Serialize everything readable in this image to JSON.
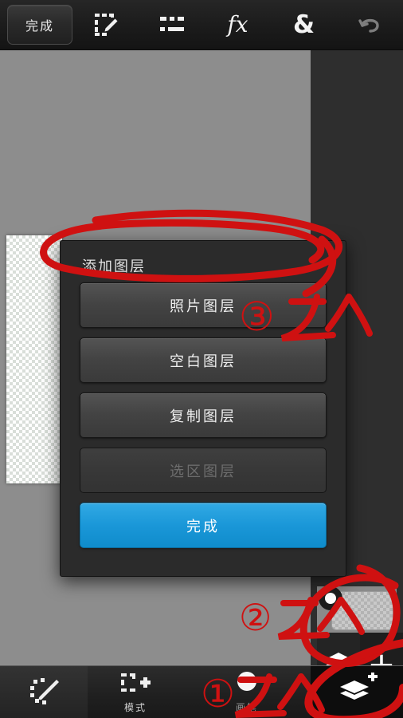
{
  "app": {
    "name": "photo-editor",
    "accent_blue": "#1a97d8",
    "annotation_red": "#cf1111",
    "canvas_background": "#8d8d8d",
    "panel_background": "#2b2b2b"
  },
  "topbar": {
    "done_label": "完成",
    "tools": [
      {
        "name": "selection-edit-icon",
        "label": "选择编辑",
        "enabled": true
      },
      {
        "name": "adjustments-icon",
        "label": "调整",
        "enabled": true
      },
      {
        "name": "effects-fx-icon",
        "label": "fx",
        "enabled": true
      },
      {
        "name": "blend-ampersand-icon",
        "label": "&",
        "enabled": true
      },
      {
        "name": "undo-icon",
        "label": "撤销",
        "enabled": false
      }
    ]
  },
  "dialog": {
    "title": "添加图层",
    "buttons": [
      {
        "label": "照片图层",
        "state": "enabled",
        "style": "normal"
      },
      {
        "label": "空白图层",
        "state": "enabled",
        "style": "normal"
      },
      {
        "label": "复制图层",
        "state": "enabled",
        "style": "normal"
      },
      {
        "label": "选区图层",
        "state": "disabled",
        "style": "normal"
      },
      {
        "label": "完成",
        "state": "enabled",
        "style": "primary"
      }
    ]
  },
  "layer_panel": {
    "thumbnail_alt": "transparent-layer-thumbnail",
    "visibility_on": true,
    "layers_button": "图层",
    "add_button": "+"
  },
  "bottombar": {
    "items": [
      {
        "name": "brush-select-icon",
        "label": ""
      },
      {
        "name": "marquee-add-icon",
        "label": "模式"
      },
      {
        "name": "brush-tool-icon",
        "label": "画笔"
      },
      {
        "name": "add-layer-icon",
        "label": ""
      }
    ]
  },
  "annotations": [
    {
      "id": "mark-1",
      "number": "①",
      "text": "这个"
    },
    {
      "id": "mark-2",
      "number": "②",
      "text": "这个"
    },
    {
      "id": "mark-3",
      "number": "③",
      "text": "这个"
    }
  ]
}
